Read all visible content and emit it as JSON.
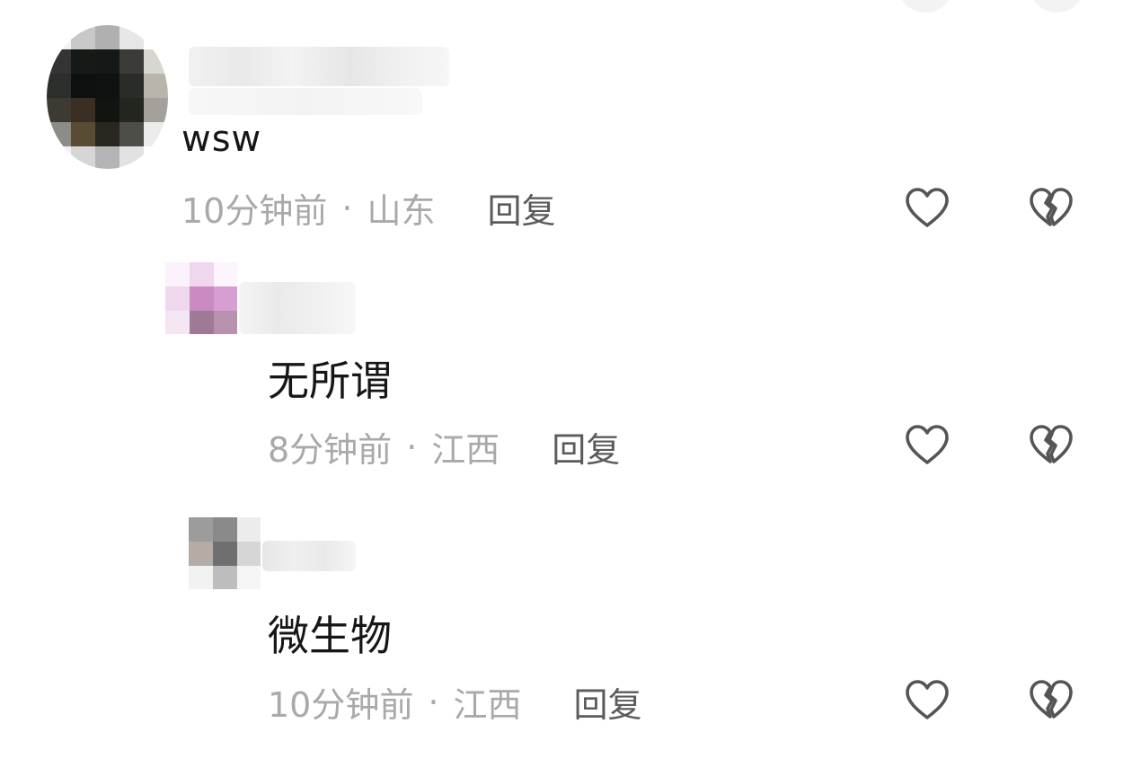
{
  "comments": [
    {
      "text": "wsw",
      "time": "10分钟前",
      "location": "山东",
      "separator": "·",
      "reply_label": "回复"
    },
    {
      "text": "无所谓",
      "time": "8分钟前",
      "location": "江西",
      "separator": "·",
      "reply_label": "回复"
    },
    {
      "text": "微生物",
      "time": "10分钟前",
      "location": "江西",
      "separator": "·",
      "reply_label": "回复"
    }
  ],
  "icons": {
    "like": "heart-outline-icon",
    "dislike": "broken-heart-icon"
  },
  "colors": {
    "text_primary": "#161616",
    "text_meta": "#a9a9a9",
    "reply": "#5b5b5b",
    "icon_stroke": "#555555"
  }
}
